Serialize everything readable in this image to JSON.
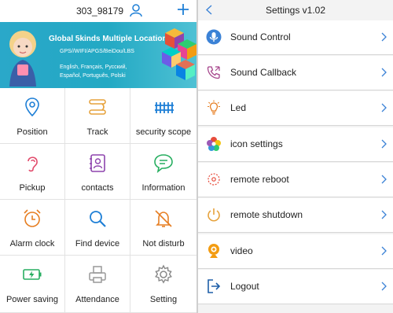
{
  "left": {
    "device_id": "303_98179",
    "banner": {
      "headline": "Global 5kinds Multiple Location",
      "tech": "GPS//WIFI/APGS/BeiDou/LBS",
      "lang1": "English, Français, Русский,",
      "lang2": "Español, Português, Polski"
    },
    "grid": [
      {
        "label": "Position",
        "icon": "location-pin-icon"
      },
      {
        "label": "Track",
        "icon": "track-route-icon"
      },
      {
        "label": "security scope",
        "icon": "fence-icon"
      },
      {
        "label": "Pickup",
        "icon": "ear-icon"
      },
      {
        "label": "contacts",
        "icon": "contacts-book-icon"
      },
      {
        "label": "Information",
        "icon": "chat-bubble-icon"
      },
      {
        "label": "Alarm clock",
        "icon": "alarm-clock-icon"
      },
      {
        "label": "Find device",
        "icon": "magnifier-icon"
      },
      {
        "label": "Not disturb",
        "icon": "muted-bell-icon"
      },
      {
        "label": "Power saving",
        "icon": "battery-icon"
      },
      {
        "label": "Attendance",
        "icon": "printer-icon"
      },
      {
        "label": "Setting",
        "icon": "gear-icon"
      }
    ]
  },
  "right": {
    "title": "Settings v1.02",
    "items": [
      {
        "label": "Sound Control",
        "icon": "microphone-icon"
      },
      {
        "label": "Sound Callback",
        "icon": "phone-callback-icon"
      },
      {
        "label": "Led",
        "icon": "lightbulb-icon"
      },
      {
        "label": "icon settings",
        "icon": "color-wheel-icon"
      },
      {
        "label": "remote reboot",
        "icon": "reboot-icon"
      },
      {
        "label": "remote shutdown",
        "icon": "power-icon"
      },
      {
        "label": "video",
        "icon": "camera-icon"
      },
      {
        "label": "Logout",
        "icon": "logout-icon"
      }
    ]
  },
  "colors": {
    "accent": "#1e7fd6",
    "banner": "#23a9c4",
    "chevron": "#3b82d6"
  }
}
